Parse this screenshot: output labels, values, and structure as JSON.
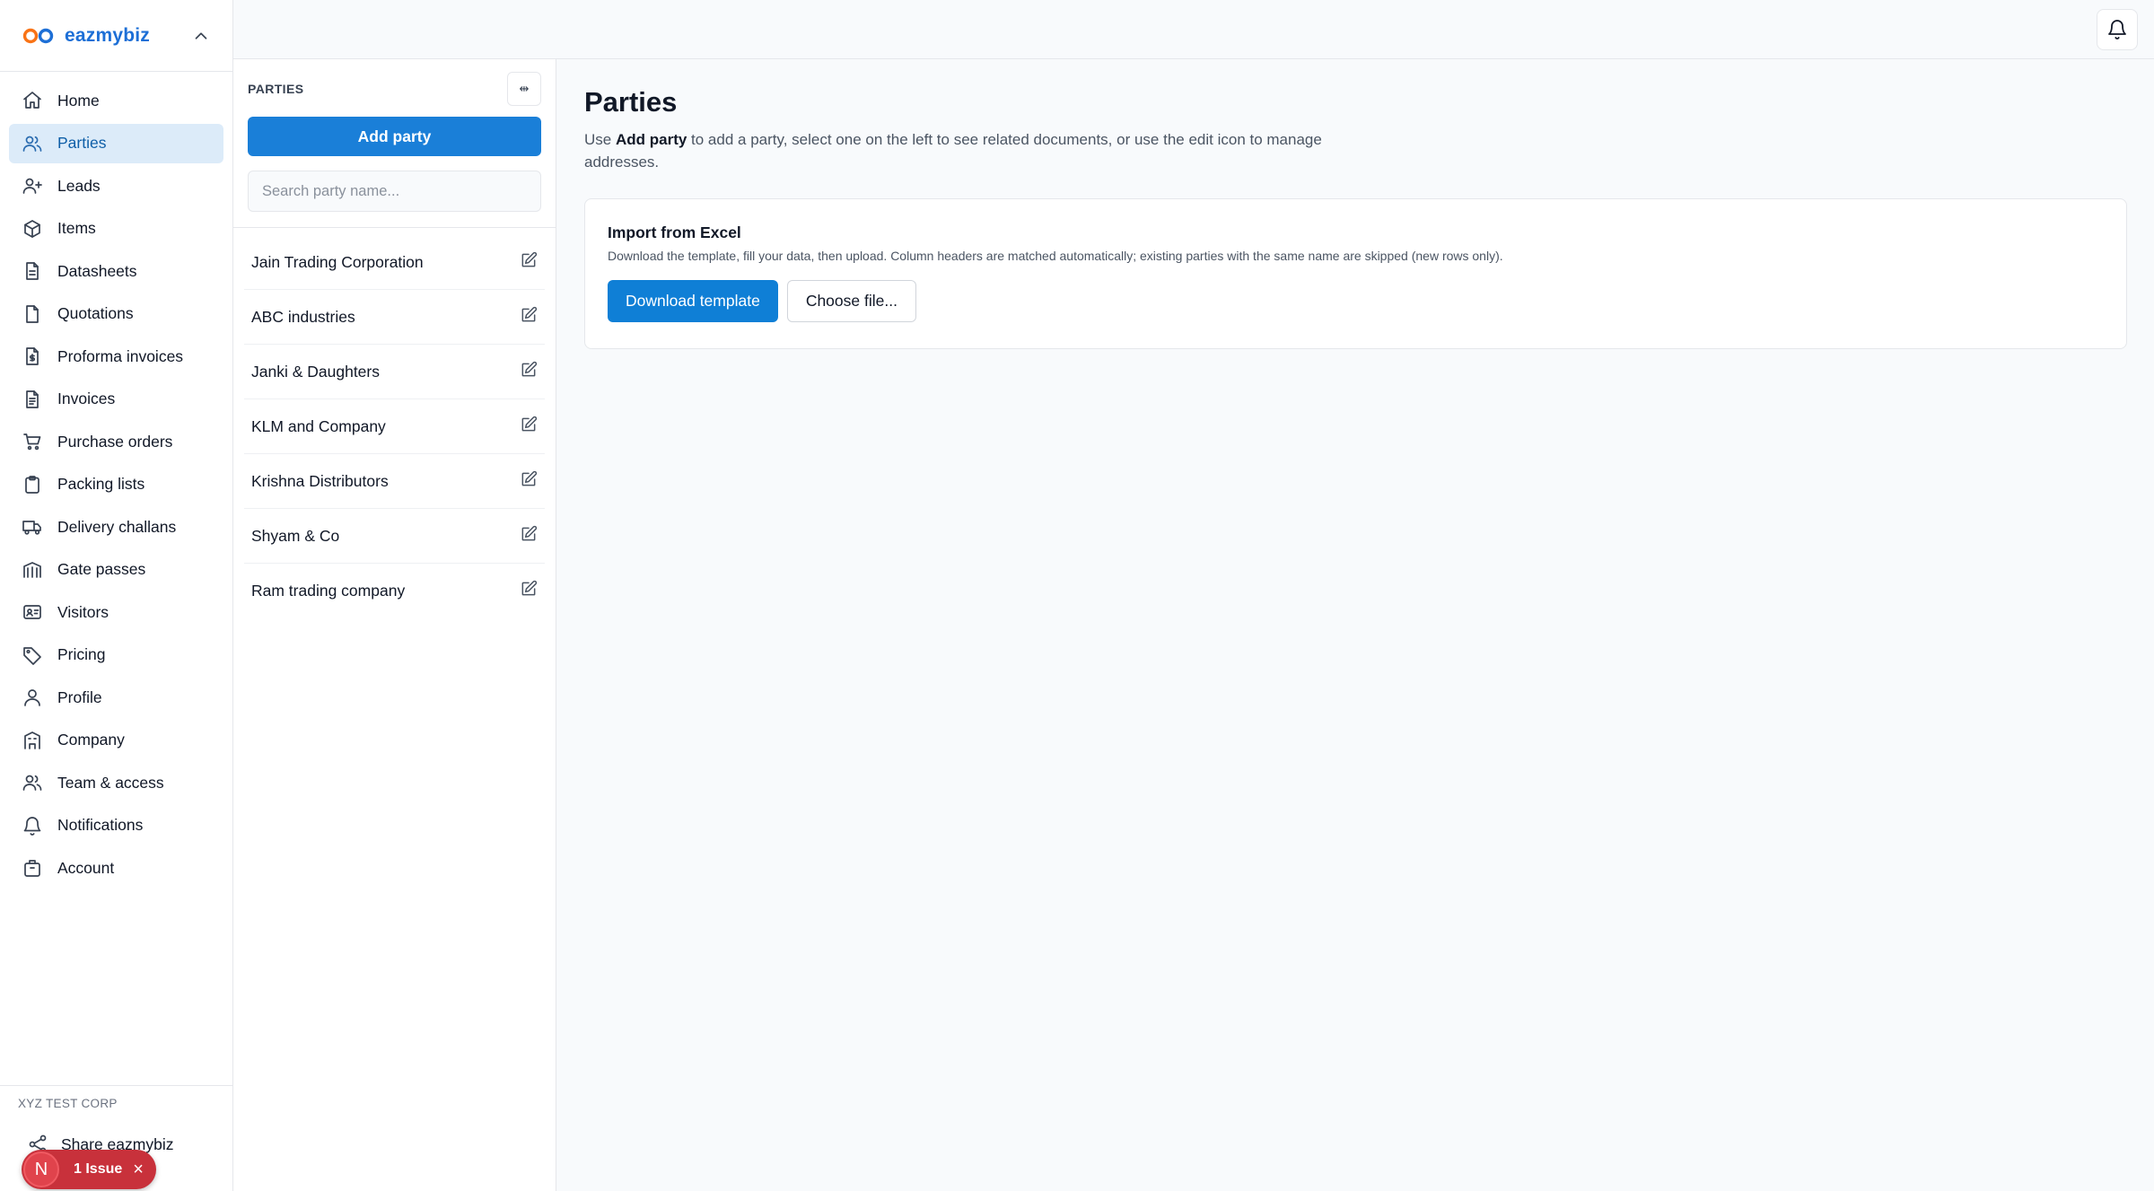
{
  "brand": {
    "name": "eazmybiz",
    "colors": {
      "primary": "#1d6fd6",
      "accent": "#f97316"
    }
  },
  "sidebar": {
    "items": [
      {
        "label": "Home",
        "icon": "home-icon"
      },
      {
        "label": "Parties",
        "icon": "users-icon",
        "active": true
      },
      {
        "label": "Leads",
        "icon": "user-plus-icon"
      },
      {
        "label": "Items",
        "icon": "box-icon"
      },
      {
        "label": "Datasheets",
        "icon": "file-text-icon"
      },
      {
        "label": "Quotations",
        "icon": "file-icon"
      },
      {
        "label": "Proforma invoices",
        "icon": "file-dollar-icon"
      },
      {
        "label": "Invoices",
        "icon": "file-lines-icon"
      },
      {
        "label": "Purchase orders",
        "icon": "cart-icon"
      },
      {
        "label": "Packing lists",
        "icon": "clipboard-icon"
      },
      {
        "label": "Delivery challans",
        "icon": "truck-icon"
      },
      {
        "label": "Gate passes",
        "icon": "gate-icon"
      },
      {
        "label": "Visitors",
        "icon": "id-card-icon"
      },
      {
        "label": "Pricing",
        "icon": "tag-icon"
      },
      {
        "label": "Profile",
        "icon": "user-icon"
      },
      {
        "label": "Company",
        "icon": "building-icon"
      },
      {
        "label": "Team & access",
        "icon": "team-icon"
      },
      {
        "label": "Notifications",
        "icon": "bell-icon"
      },
      {
        "label": "Account",
        "icon": "briefcase-icon"
      }
    ],
    "footer": {
      "org": "XYZ TEST CORP",
      "share_label": "Share eazmybiz"
    }
  },
  "issue_badge": {
    "avatar": "N",
    "label": "1 Issue",
    "close": "×"
  },
  "panel": {
    "title": "PARTIES",
    "collapse_label": "⇹",
    "add_label": "Add party",
    "search_placeholder": "Search party name...",
    "parties": [
      "Jain Trading Corporation",
      "ABC industries",
      "Janki & Daughters",
      "KLM and Company",
      "Krishna Distributors",
      "Shyam & Co",
      "Ram trading company"
    ]
  },
  "main": {
    "title": "Parties",
    "desc_prefix": "Use ",
    "desc_bold": "Add party",
    "desc_suffix": " to add a party, select one on the left to see related documents, or use the edit icon to manage addresses.",
    "import": {
      "title": "Import from Excel",
      "desc": "Download the template, fill your data, then upload. Column headers are matched automatically; existing parties with the same name are skipped (new rows only).",
      "download_label": "Download template",
      "choose_label": "Choose file..."
    }
  }
}
